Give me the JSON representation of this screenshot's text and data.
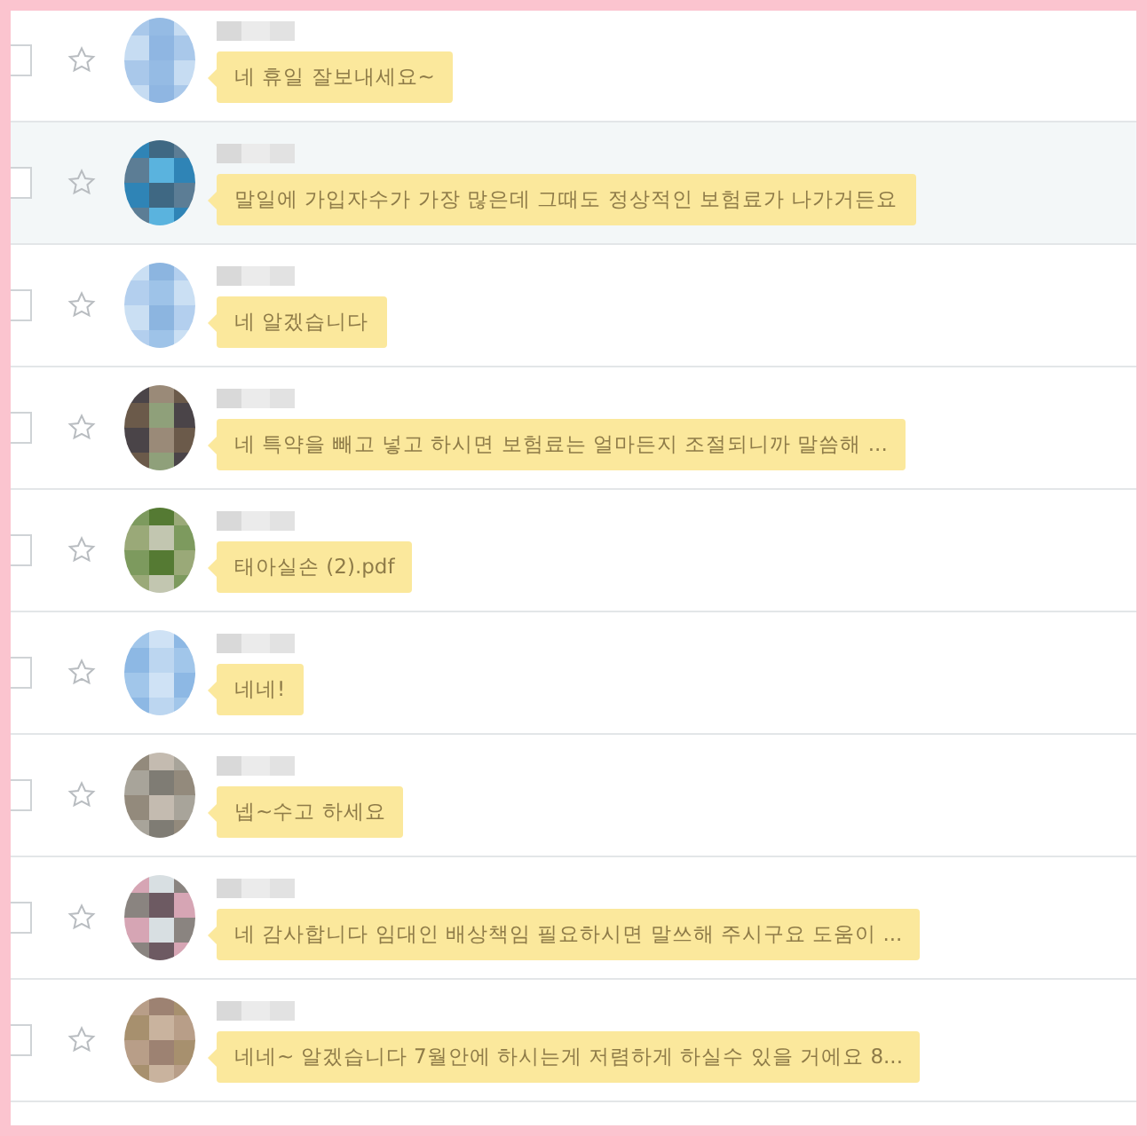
{
  "conversations": [
    {
      "selected": false,
      "checked": false,
      "starred": false,
      "message": "네 휴일 잘보내세요~"
    },
    {
      "selected": true,
      "checked": false,
      "starred": false,
      "message": "말일에 가입자수가 가장 많은데 그때도 정상적인 보험료가 나가거든요"
    },
    {
      "selected": false,
      "checked": false,
      "starred": false,
      "message": "네 알겠습니다"
    },
    {
      "selected": false,
      "checked": false,
      "starred": false,
      "message": "네 특약을 빼고 넣고 하시면 보험료는 얼마든지 조절되니까 말씀해 ..."
    },
    {
      "selected": false,
      "checked": false,
      "starred": false,
      "message": "태아실손 (2).pdf"
    },
    {
      "selected": false,
      "checked": false,
      "starred": false,
      "message": "네네!"
    },
    {
      "selected": false,
      "checked": false,
      "starred": false,
      "message": "넵~수고 하세요"
    },
    {
      "selected": false,
      "checked": false,
      "starred": false,
      "message": "네 감사합니다 임대인 배상책임 필요하시면 말쓰해 주시구요 도움이 ..."
    },
    {
      "selected": false,
      "checked": false,
      "starred": false,
      "message": "네네~ 알겠습니다 7월안에 하시는게 저렴하게 하실수 있을 거에요 8..."
    }
  ]
}
